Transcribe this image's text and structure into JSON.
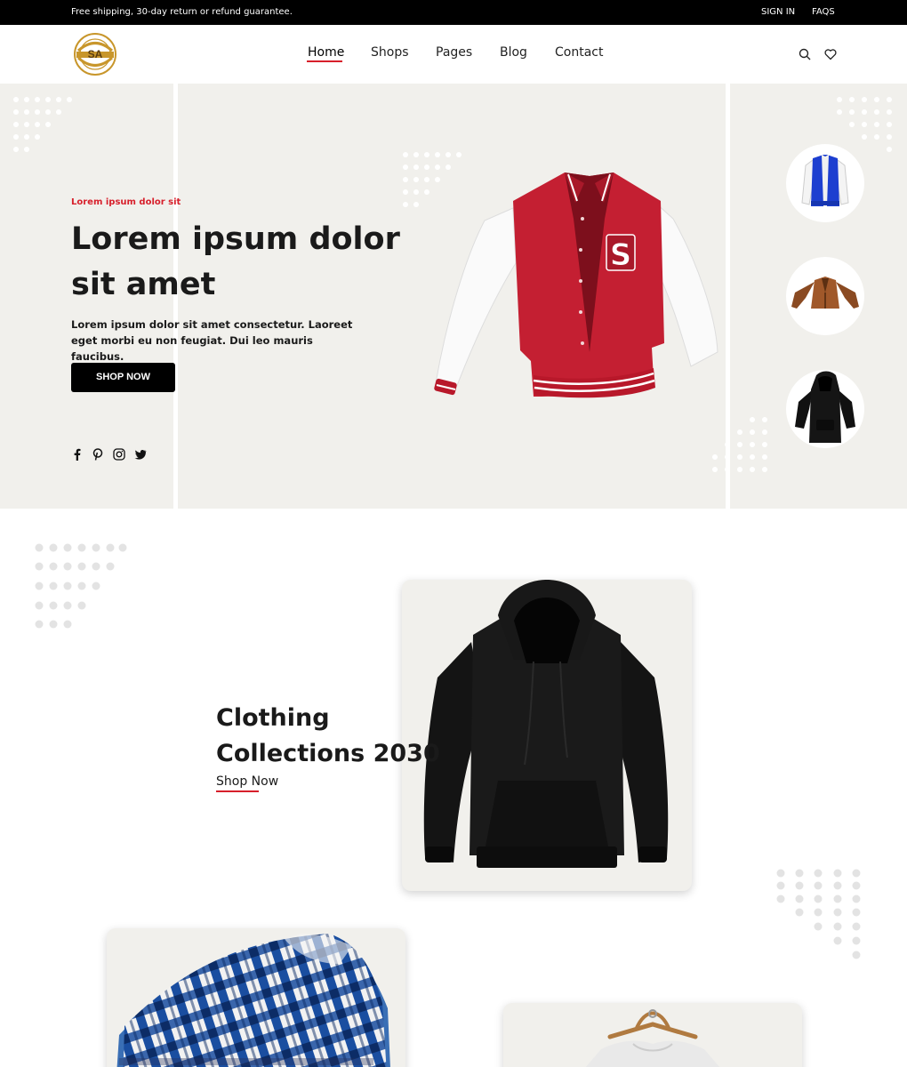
{
  "topbar": {
    "promo": "Free shipping, 30-day return or refund guarantee.",
    "sign_in": "SIGN IN",
    "faqs": "FAQS"
  },
  "header": {
    "logo_text": "SA",
    "nav": [
      "Home",
      "Shops",
      "Pages",
      "Blog",
      "Contact"
    ],
    "active_nav": "Home",
    "icons": [
      "search-icon",
      "heart-icon"
    ]
  },
  "hero": {
    "eyebrow": "Lorem ipsum dolor sit",
    "title": "Lorem ipsum dolor sit amet",
    "description": "Lorem ipsum dolor sit amet consectetur. Laoreet eget morbi eu non feugiat. Dui leo mauris faucibus.",
    "cta": "SHOP NOW",
    "social": [
      "facebook-icon",
      "pinterest-icon",
      "instagram-icon",
      "twitter-icon"
    ],
    "main_product": "varsity-jacket",
    "thumbnails": [
      "blue-varsity-jacket",
      "brown-leather-jacket",
      "black-hoodie"
    ]
  },
  "collection": {
    "title": "Clothing Collections 2030",
    "link": "Shop Now",
    "products": [
      "black-hoodie",
      "plaid-shirts",
      "white-tshirt"
    ]
  },
  "colors": {
    "accent": "#d71f2b",
    "hero_bg": "#f1f0ec",
    "black": "#000000"
  }
}
